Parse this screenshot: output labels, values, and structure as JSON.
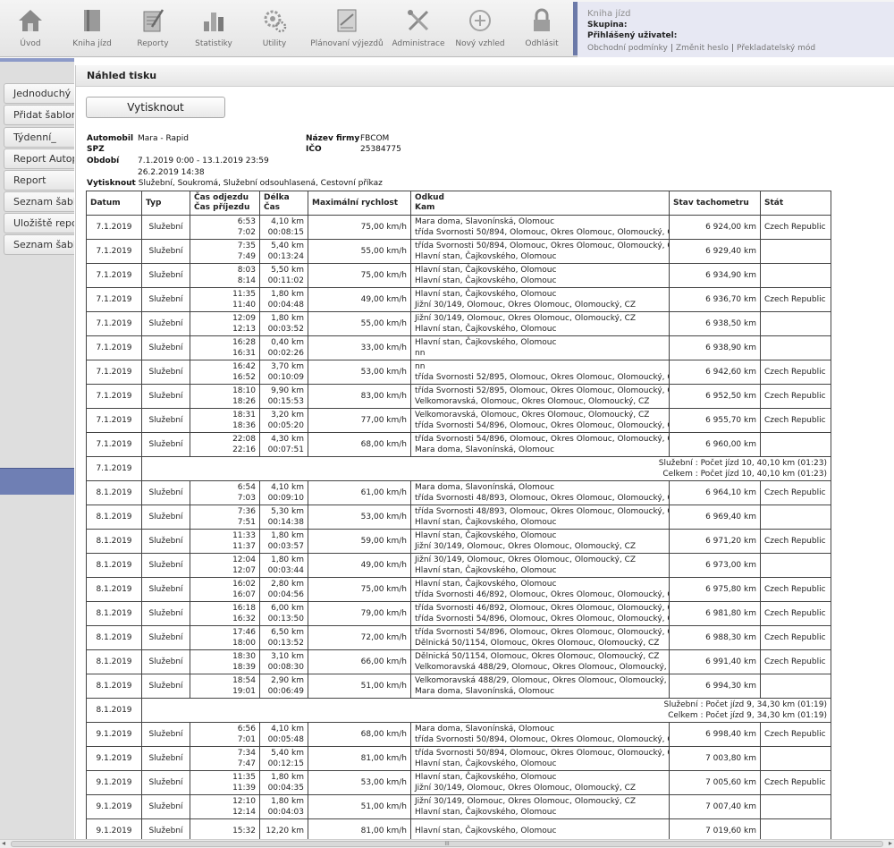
{
  "toolbar": {
    "items": [
      {
        "label": "Úvod",
        "icon": "home-icon"
      },
      {
        "label": "Kniha jízd",
        "icon": "book-icon"
      },
      {
        "label": "Reporty",
        "icon": "reports-icon"
      },
      {
        "label": "Statistiky",
        "icon": "statistics-icon"
      },
      {
        "label": "Utility",
        "icon": "gears-icon"
      },
      {
        "label": "Plánovaní výjezdů",
        "icon": "planning-icon"
      },
      {
        "label": "Administrace",
        "icon": "tools-icon"
      },
      {
        "label": "Nový vzhled",
        "icon": "new-look-icon"
      },
      {
        "label": "Odhlásit",
        "icon": "lock-icon"
      }
    ]
  },
  "info": {
    "title": "Kniha jízd",
    "group_label": "Skupina:",
    "user_label": "Přihlášený uživatel:",
    "links": [
      "Obchodní podmínky",
      "Změnit heslo",
      "Překladatelský mód"
    ]
  },
  "sidebar": {
    "items": [
      "Jednoduchý re",
      "Přidat šablonu",
      "Týdenní_",
      "Report Autopa",
      "Report",
      "Seznam šablon",
      "Uložiště report",
      "Seznam šablon"
    ]
  },
  "main": {
    "title": "Náhled tisku",
    "print_button": "Vytisknout"
  },
  "report_meta": {
    "vehicle_label": "Automobil",
    "vehicle_value": "Mara - Rapid",
    "spz_label": "SPZ",
    "period_label": "Období",
    "period_value": "7.1.2019 0:00 - 13.1.2019 23:59",
    "period_date2": "26.2.2019 14:38",
    "print_label": "Vytisknout",
    "print_value": "Služební, Soukromá, Služební odsouhlasená, Cestovní příkaz",
    "company_label": "Název firmy",
    "company_value": "FBCOM",
    "ico_label": "IČO",
    "ico_value": "25384775"
  },
  "table": {
    "headers": {
      "date": "Datum",
      "type": "Typ",
      "dep": "Čas odjezdu",
      "arr": "Čas příjezdu",
      "len": "Délka",
      "time": "Čas",
      "speed": "Maximální rychlost",
      "from": "Odkud",
      "to": "Kam",
      "odo": "Stav tachometru",
      "state": "Stát"
    },
    "rows": [
      {
        "kind": "trip",
        "date": "7.1.2019",
        "type": "Služební",
        "dep": "6:53",
        "arr": "7:02",
        "km": "4,10 km",
        "dur": "00:08:15",
        "speed": "75,00 km/h",
        "from": "Mara doma, Slavonínská, Olomouc",
        "to": "třída Svornosti 50/894, Olomouc, Okres Olomouc, Olomoucký, CZ",
        "odo": "6 924,00 km",
        "state": "Czech Republic"
      },
      {
        "kind": "trip",
        "date": "7.1.2019",
        "type": "Služební",
        "dep": "7:35",
        "arr": "7:49",
        "km": "5,40 km",
        "dur": "00:13:24",
        "speed": "55,00 km/h",
        "from": "třída Svornosti 50/894, Olomouc, Okres Olomouc, Olomoucký, CZ",
        "to": "Hlavní stan, Čajkovského, Olomouc",
        "odo": "6 929,40 km",
        "state": ""
      },
      {
        "kind": "trip",
        "date": "7.1.2019",
        "type": "Služební",
        "dep": "8:03",
        "arr": "8:14",
        "km": "5,50 km",
        "dur": "00:11:02",
        "speed": "75,00 km/h",
        "from": "Hlavní stan, Čajkovského, Olomouc",
        "to": "Hlavní stan, Čajkovského, Olomouc",
        "odo": "6 934,90 km",
        "state": ""
      },
      {
        "kind": "trip",
        "date": "7.1.2019",
        "type": "Služební",
        "dep": "11:35",
        "arr": "11:40",
        "km": "1,80 km",
        "dur": "00:04:48",
        "speed": "49,00 km/h",
        "from": "Hlavní stan, Čajkovského, Olomouc",
        "to": "Jižní 30/149, Olomouc, Okres Olomouc, Olomoucký, CZ",
        "odo": "6 936,70 km",
        "state": "Czech Republic"
      },
      {
        "kind": "trip",
        "date": "7.1.2019",
        "type": "Služební",
        "dep": "12:09",
        "arr": "12:13",
        "km": "1,80 km",
        "dur": "00:03:52",
        "speed": "55,00 km/h",
        "from": "Jižní 30/149, Olomouc, Okres Olomouc, Olomoucký, CZ",
        "to": "Hlavní stan, Čajkovského, Olomouc",
        "odo": "6 938,50 km",
        "state": ""
      },
      {
        "kind": "trip",
        "date": "7.1.2019",
        "type": "Služební",
        "dep": "16:28",
        "arr": "16:31",
        "km": "0,40 km",
        "dur": "00:02:26",
        "speed": "33,00 km/h",
        "from": "Hlavní stan, Čajkovského, Olomouc",
        "to": "nn",
        "odo": "6 938,90 km",
        "state": ""
      },
      {
        "kind": "trip",
        "date": "7.1.2019",
        "type": "Služební",
        "dep": "16:42",
        "arr": "16:52",
        "km": "3,70 km",
        "dur": "00:10:09",
        "speed": "53,00 km/h",
        "from": "nn",
        "to": "třída Svornosti 52/895, Olomouc, Okres Olomouc, Olomoucký, CZ",
        "odo": "6 942,60 km",
        "state": "Czech Republic"
      },
      {
        "kind": "trip",
        "date": "7.1.2019",
        "type": "Služební",
        "dep": "18:10",
        "arr": "18:26",
        "km": "9,90 km",
        "dur": "00:15:53",
        "speed": "83,00 km/h",
        "from": "třída Svornosti 52/895, Olomouc, Okres Olomouc, Olomoucký, CZ",
        "to": "Velkomoravská, Olomouc, Okres Olomouc, Olomoucký, CZ",
        "odo": "6 952,50 km",
        "state": "Czech Republic"
      },
      {
        "kind": "trip",
        "date": "7.1.2019",
        "type": "Služební",
        "dep": "18:31",
        "arr": "18:36",
        "km": "3,20 km",
        "dur": "00:05:20",
        "speed": "77,00 km/h",
        "from": "Velkomoravská, Olomouc, Okres Olomouc, Olomoucký, CZ",
        "to": "třída Svornosti 54/896, Olomouc, Okres Olomouc, Olomoucký, CZ",
        "odo": "6 955,70 km",
        "state": "Czech Republic"
      },
      {
        "kind": "trip",
        "date": "7.1.2019",
        "type": "Služební",
        "dep": "22:08",
        "arr": "22:16",
        "km": "4,30 km",
        "dur": "00:07:51",
        "speed": "68,00 km/h",
        "from": "třída Svornosti 54/896, Olomouc, Okres Olomouc, Olomoucký, CZ",
        "to": "Mara doma, Slavonínská, Olomouc",
        "odo": "6 960,00 km",
        "state": ""
      },
      {
        "kind": "summary",
        "date": "7.1.2019",
        "line1": "Služební : Počet jízd 10, 40,10  km (01:23)",
        "line2": "Celkem : Počet jízd 10, 40,10  km (01:23)"
      },
      {
        "kind": "trip",
        "date": "8.1.2019",
        "type": "Služební",
        "dep": "6:54",
        "arr": "7:03",
        "km": "4,10 km",
        "dur": "00:09:10",
        "speed": "61,00 km/h",
        "from": "Mara doma, Slavonínská, Olomouc",
        "to": "třída Svornosti 48/893, Olomouc, Okres Olomouc, Olomoucký, CZ",
        "odo": "6 964,10 km",
        "state": "Czech Republic"
      },
      {
        "kind": "trip",
        "date": "8.1.2019",
        "type": "Služební",
        "dep": "7:36",
        "arr": "7:51",
        "km": "5,30 km",
        "dur": "00:14:38",
        "speed": "53,00 km/h",
        "from": "třída Svornosti 48/893, Olomouc, Okres Olomouc, Olomoucký, CZ",
        "to": "Hlavní stan, Čajkovského, Olomouc",
        "odo": "6 969,40 km",
        "state": ""
      },
      {
        "kind": "trip",
        "date": "8.1.2019",
        "type": "Služební",
        "dep": "11:33",
        "arr": "11:37",
        "km": "1,80 km",
        "dur": "00:03:57",
        "speed": "59,00 km/h",
        "from": "Hlavní stan, Čajkovského, Olomouc",
        "to": "Jižní 30/149, Olomouc, Okres Olomouc, Olomoucký, CZ",
        "odo": "6 971,20 km",
        "state": "Czech Republic"
      },
      {
        "kind": "trip",
        "date": "8.1.2019",
        "type": "Služební",
        "dep": "12:04",
        "arr": "12:07",
        "km": "1,80 km",
        "dur": "00:03:44",
        "speed": "49,00 km/h",
        "from": "Jižní 30/149, Olomouc, Okres Olomouc, Olomoucký, CZ",
        "to": "Hlavní stan, Čajkovského, Olomouc",
        "odo": "6 973,00 km",
        "state": ""
      },
      {
        "kind": "trip",
        "date": "8.1.2019",
        "type": "Služební",
        "dep": "16:02",
        "arr": "16:07",
        "km": "2,80 km",
        "dur": "00:04:56",
        "speed": "75,00 km/h",
        "from": "Hlavní stan, Čajkovského, Olomouc",
        "to": "třída Svornosti 46/892, Olomouc, Okres Olomouc, Olomoucký, CZ",
        "odo": "6 975,80 km",
        "state": "Czech Republic"
      },
      {
        "kind": "trip",
        "date": "8.1.2019",
        "type": "Služební",
        "dep": "16:18",
        "arr": "16:32",
        "km": "6,00 km",
        "dur": "00:13:50",
        "speed": "79,00 km/h",
        "from": "třída Svornosti 46/892, Olomouc, Okres Olomouc, Olomoucký, CZ",
        "to": "třída Svornosti 54/896, Olomouc, Okres Olomouc, Olomoucký, CZ",
        "odo": "6 981,80 km",
        "state": "Czech Republic"
      },
      {
        "kind": "trip",
        "date": "8.1.2019",
        "type": "Služební",
        "dep": "17:46",
        "arr": "18:00",
        "km": "6,50 km",
        "dur": "00:13:52",
        "speed": "72,00 km/h",
        "from": "třída Svornosti 54/896, Olomouc, Okres Olomouc, Olomoucký, CZ",
        "to": "Dělnická 50/1154, Olomouc, Okres Olomouc, Olomoucký, CZ",
        "odo": "6 988,30 km",
        "state": "Czech Republic"
      },
      {
        "kind": "trip",
        "date": "8.1.2019",
        "type": "Služební",
        "dep": "18:30",
        "arr": "18:39",
        "km": "3,10 km",
        "dur": "00:08:30",
        "speed": "66,00 km/h",
        "from": "Dělnická 50/1154, Olomouc, Okres Olomouc, Olomoucký, CZ",
        "to": "Velkomoravská 488/29, Olomouc, Okres Olomouc, Olomoucký, CZ",
        "odo": "6 991,40 km",
        "state": "Czech Republic"
      },
      {
        "kind": "trip",
        "date": "8.1.2019",
        "type": "Služební",
        "dep": "18:54",
        "arr": "19:01",
        "km": "2,90 km",
        "dur": "00:06:49",
        "speed": "51,00 km/h",
        "from": "Velkomoravská 488/29, Olomouc, Okres Olomouc, Olomoucký, CZ",
        "to": "Mara doma, Slavonínská, Olomouc",
        "odo": "6 994,30 km",
        "state": ""
      },
      {
        "kind": "summary",
        "date": "8.1.2019",
        "line1": "Služební : Počet jízd 9, 34,30  km (01:19)",
        "line2": "Celkem : Počet jízd 9, 34,30  km (01:19)"
      },
      {
        "kind": "trip",
        "date": "9.1.2019",
        "type": "Služební",
        "dep": "6:56",
        "arr": "7:01",
        "km": "4,10 km",
        "dur": "00:05:48",
        "speed": "68,00 km/h",
        "from": "Mara doma, Slavonínská, Olomouc",
        "to": "třída Svornosti 50/894, Olomouc, Okres Olomouc, Olomoucký, CZ",
        "odo": "6 998,40 km",
        "state": "Czech Republic"
      },
      {
        "kind": "trip",
        "date": "9.1.2019",
        "type": "Služební",
        "dep": "7:34",
        "arr": "7:47",
        "km": "5,40 km",
        "dur": "00:12:15",
        "speed": "81,00 km/h",
        "from": "třída Svornosti 50/894, Olomouc, Okres Olomouc, Olomoucký, CZ",
        "to": "Hlavní stan, Čajkovského, Olomouc",
        "odo": "7 003,80 km",
        "state": ""
      },
      {
        "kind": "trip",
        "date": "9.1.2019",
        "type": "Služební",
        "dep": "11:35",
        "arr": "11:39",
        "km": "1,80 km",
        "dur": "00:04:35",
        "speed": "53,00 km/h",
        "from": "Hlavní stan, Čajkovského, Olomouc",
        "to": "Jižní 30/149, Olomouc, Okres Olomouc, Olomoucký, CZ",
        "odo": "7 005,60 km",
        "state": "Czech Republic"
      },
      {
        "kind": "trip",
        "date": "9.1.2019",
        "type": "Služební",
        "dep": "12:10",
        "arr": "12:14",
        "km": "1,80 km",
        "dur": "00:04:03",
        "speed": "51,00 km/h",
        "from": "Jižní 30/149, Olomouc, Okres Olomouc, Olomoucký, CZ",
        "to": "Hlavní stan, Čajkovského, Olomouc",
        "odo": "7 007,40 km",
        "state": ""
      },
      {
        "kind": "trip",
        "date": "9.1.2019",
        "type": "Služební",
        "dep": "15:32",
        "arr": "",
        "km": "12,20 km",
        "dur": "",
        "speed": "81,00 km/h",
        "from": "Hlavní stan, Čajkovského, Olomouc",
        "to": "",
        "odo": "7 019,60 km",
        "state": ""
      }
    ]
  },
  "scrollbar": {
    "grip": "III",
    "left_arrow": "◂",
    "right_arrow": "▸"
  }
}
